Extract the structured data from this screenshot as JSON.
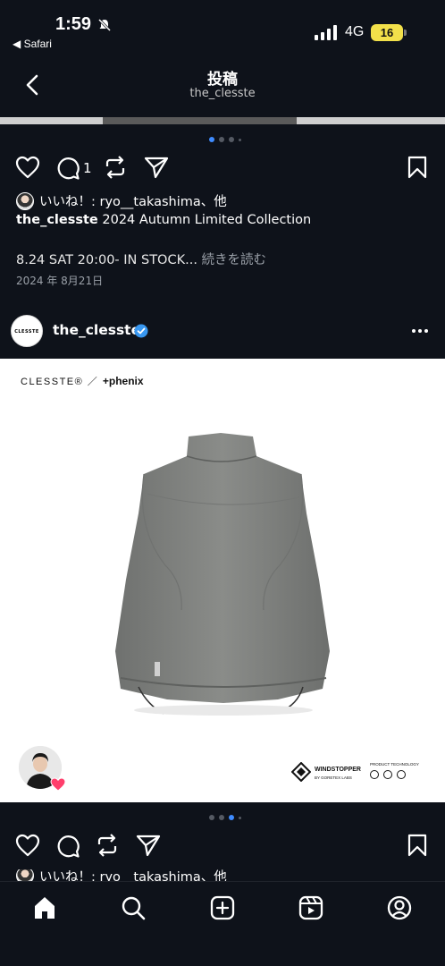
{
  "status_bar": {
    "time": "1:59",
    "back_app": "◀ Safari",
    "network": "4G",
    "battery": "16"
  },
  "header": {
    "title": "投稿",
    "subtitle": "the_clesste"
  },
  "post1": {
    "comment_count": "1",
    "likes_text": "いいね！: ryo__takashima、他",
    "caption_user": "the_clesste",
    "caption_text": " 2024 Autumn Limited Collection",
    "caption_line2": "8.24 SAT 20:00- IN STOCK...",
    "more_label": " 続きを読む",
    "date": "2024 年 8月21日"
  },
  "post2": {
    "avatar_text": "CLESSTE",
    "username": "the_clesste",
    "brand_left": "CLESSTE® ／",
    "brand_right": "+phenix",
    "windstopper_line1": "WINDSTOPPER",
    "windstopper_line2": "BY GORETEX LABS",
    "tech_label": "PRODUCT TECHNOLOGY",
    "likes_text": "いいね！: ryo__takashima、他"
  },
  "tabs": [
    "home",
    "search",
    "create",
    "reels",
    "profile"
  ],
  "colors": {
    "background": "#0e121a",
    "accent": "#3f8cff",
    "verified": "#3897f0",
    "battery": "#f2e04a"
  }
}
